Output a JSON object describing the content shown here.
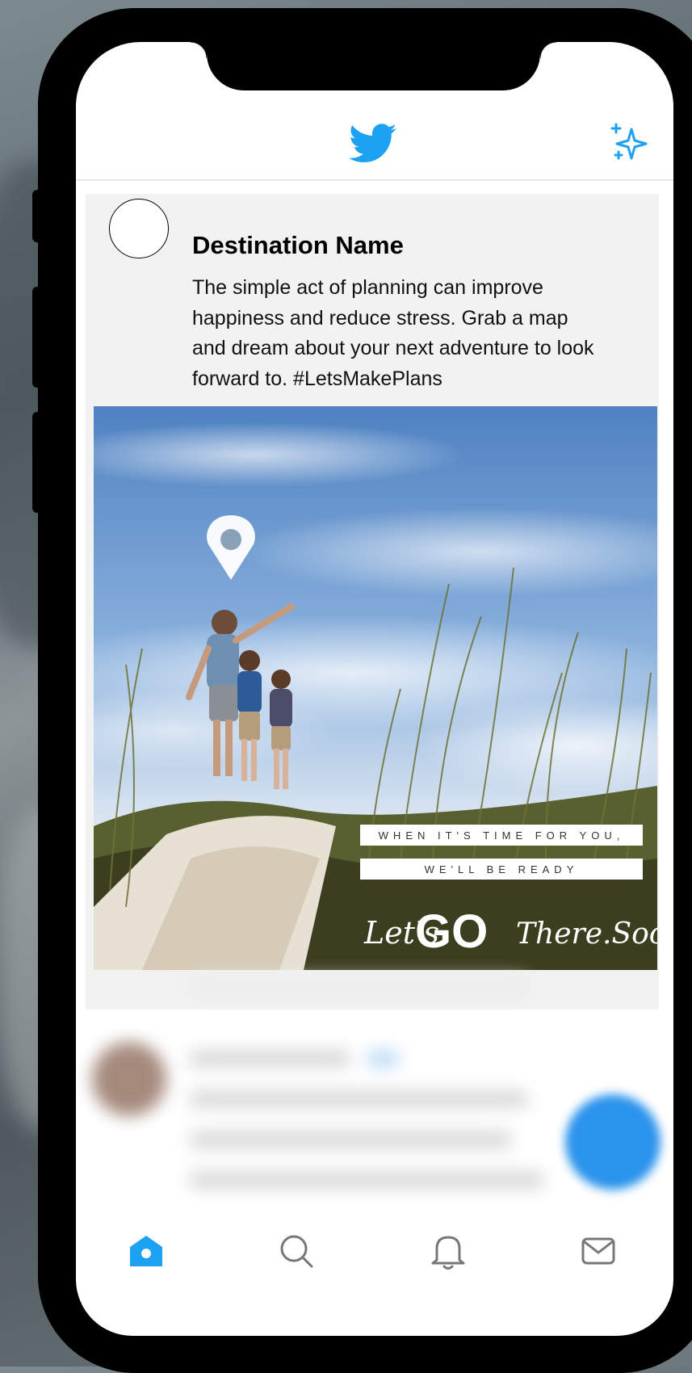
{
  "header": {
    "logo_icon": "twitter-bird-icon",
    "sparkle_icon": "sparkle-icon",
    "accent_color": "#1da1f2"
  },
  "tweet": {
    "author": "Destination Name",
    "text": "The simple act of planning can improve happiness and reduce stress. Grab a map and dream about your next adventure to look forward to. #LetsMakePlans"
  },
  "image_overlay": {
    "line1": "WHEN IT'S TIME FOR YOU,",
    "line2": "WE'LL BE READY",
    "brand_lets": "Let's",
    "brand_go": "GO",
    "brand_there_soon": "There.Soon"
  },
  "tabbar": {
    "items": [
      {
        "icon": "home-icon",
        "active": true
      },
      {
        "icon": "search-icon",
        "active": false
      },
      {
        "icon": "bell-icon",
        "active": false
      },
      {
        "icon": "mail-icon",
        "active": false
      }
    ]
  }
}
